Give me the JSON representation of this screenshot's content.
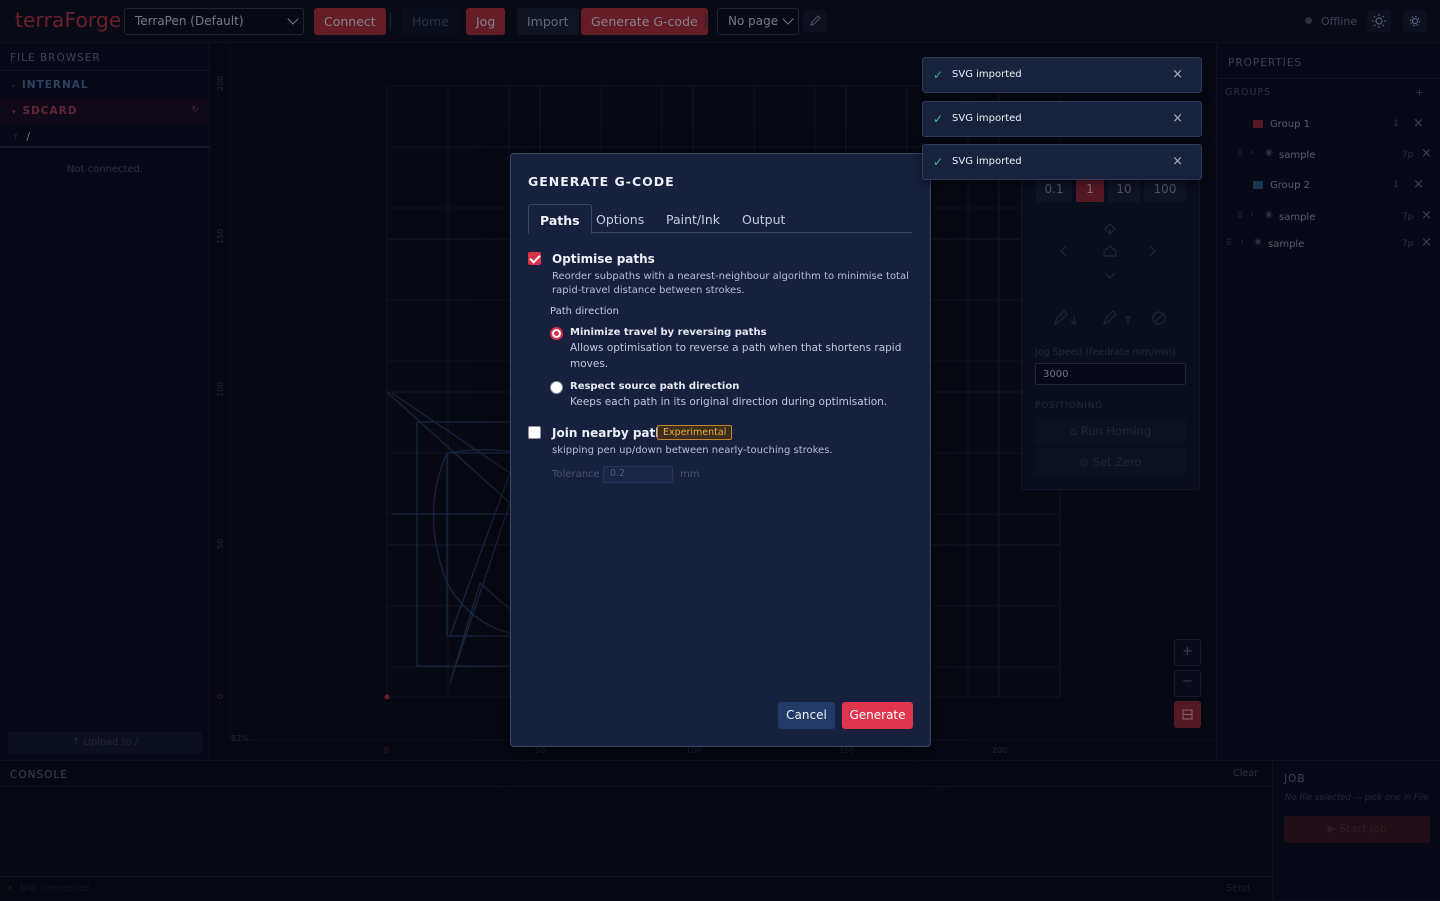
{
  "app": {
    "logo": "terraForge"
  },
  "toolbar": {
    "device_select": "TerraPen (Default)",
    "connect": "Connect",
    "home": "Home",
    "jog": "Jog",
    "import": "Import",
    "generate_gcode": "Generate G-code",
    "page_select": "No page",
    "status": "Offline"
  },
  "file_browser": {
    "title": "FILE BROWSER",
    "internal": "INTERNAL",
    "sdcard": "SDCARD",
    "path": "/",
    "message": "Not connected.",
    "upload": "↑ Upload to /"
  },
  "canvas": {
    "y_ticks": [
      "200",
      "150",
      "100",
      "50",
      "0"
    ],
    "x_ticks": [
      "0",
      "50",
      "100",
      "150",
      "200"
    ],
    "zoom": "82%"
  },
  "jog_panel": {
    "steps": [
      "0.1",
      "1",
      "10",
      "100"
    ],
    "active_step": "1",
    "speed_label": "Jog Speed (feedrate mm/min)",
    "speed_value": "3000",
    "positioning": "POSITIONING",
    "run_homing": "Run Homing",
    "set_zero": "Set Zero"
  },
  "properties": {
    "title": "PROPERTIES",
    "groups_title": "GROUPS",
    "rows": [
      {
        "label": "Group 1",
        "count": "1",
        "type": "group",
        "color": "#b8303f"
      },
      {
        "label": "sample",
        "count": "7p",
        "type": "item"
      },
      {
        "label": "Group 2",
        "count": "1",
        "type": "group",
        "color": "#2a6fa8"
      },
      {
        "label": "sample",
        "count": "7p",
        "type": "item"
      },
      {
        "label": "sample",
        "count": "7p",
        "type": "item-root"
      }
    ]
  },
  "console": {
    "title": "CONSOLE",
    "clear": "Clear",
    "placeholder": "Not connected",
    "send": "Send"
  },
  "job": {
    "title": "JOB",
    "message": "No file selected — pick one in File",
    "start": "▶ Start job"
  },
  "toasts": [
    "SVG imported",
    "SVG imported",
    "SVG imported"
  ],
  "modal": {
    "title": "GENERATE G-CODE",
    "tabs": [
      "Paths",
      "Options",
      "Paint/Ink",
      "Output"
    ],
    "optimise": {
      "title": "Optimise paths",
      "desc1": "Reorder subpaths with a nearest-neighbour algorithm to minimise total",
      "desc2": "rapid-travel distance between strokes."
    },
    "path_direction": "Path direction",
    "minimize": {
      "title": "Minimize travel by reversing paths",
      "desc1": "Allows optimisation to reverse a path when that shortens rapid",
      "desc2": "moves."
    },
    "respect": {
      "title": "Respect source path direction",
      "desc": "Keeps each path in its original direction during optimisation."
    },
    "join": {
      "title": "Join nearby paths",
      "badge": "Experimental",
      "desc": "skipping pen up/down between nearly-touching strokes."
    },
    "tolerance": {
      "label": "Tolerance",
      "value": "0.2",
      "unit": "mm"
    },
    "cancel": "Cancel",
    "generate": "Generate"
  }
}
